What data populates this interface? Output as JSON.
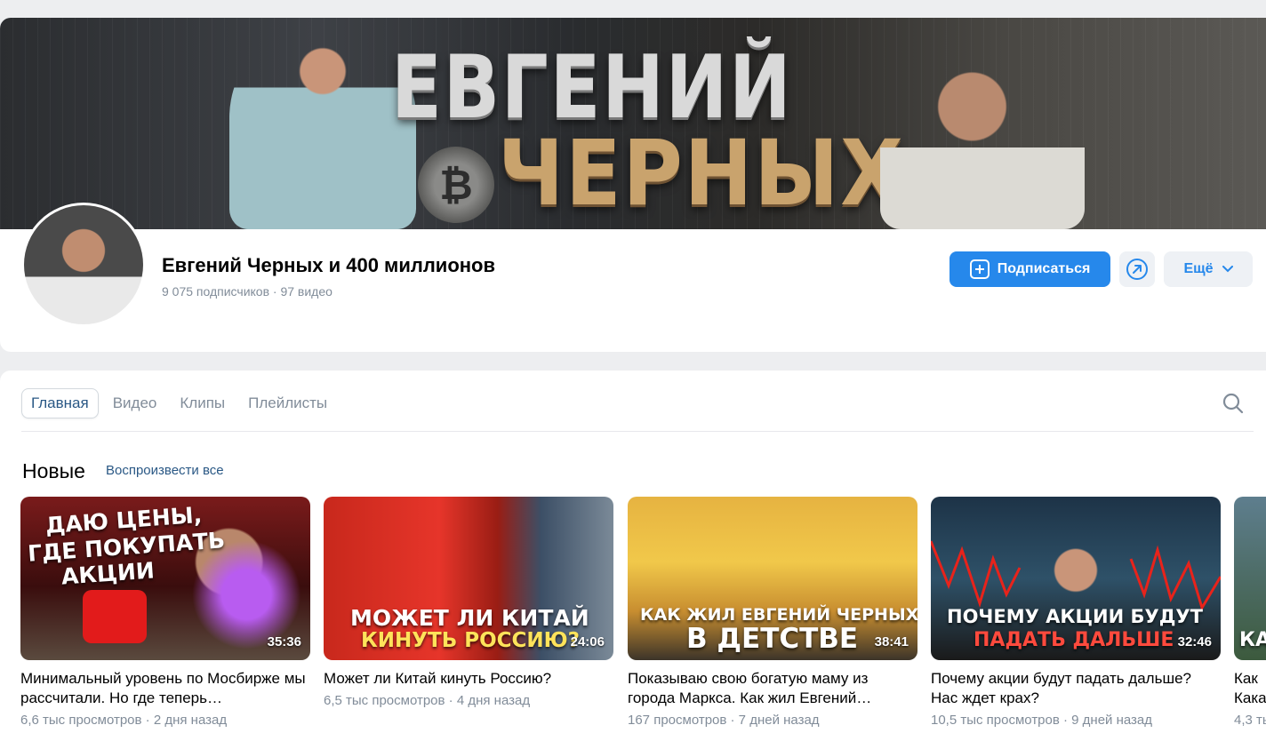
{
  "channel": {
    "cover_title_line1": "ЕВГЕНИЙ",
    "cover_title_line2": "ЧЕРНЫХ",
    "name": "Евгений Черных и 400 миллионов",
    "stats": "9 075 подписчиков · 97 видео",
    "subscribe_label": "Подписаться",
    "more_label": "Ещё",
    "accent_color": "#2688eb"
  },
  "tabs": [
    {
      "label": "Главная",
      "active": true
    },
    {
      "label": "Видео",
      "active": false
    },
    {
      "label": "Клипы",
      "active": false
    },
    {
      "label": "Плейлисты",
      "active": false
    }
  ],
  "section": {
    "title": "Новые",
    "play_all": "Воспроизвести все"
  },
  "videos": [
    {
      "thumb_text": [
        "ДАЮ ЦЕНЫ,",
        "ГДЕ ПОКУПАТЬ",
        "АКЦИИ"
      ],
      "duration": "35:36",
      "title": "Минимальный уровень по Мосбирже мы рассчитали. Но где теперь…",
      "meta": "6,6 тыс просмотров · 2 дня назад"
    },
    {
      "thumb_text": [
        "МОЖЕТ ЛИ КИТАЙ",
        "КИНУТЬ РОССИЮ?"
      ],
      "duration": "24:06",
      "title": "Может ли Китай кинуть Россию?",
      "meta": "6,5 тыс просмотров · 4 дня назад"
    },
    {
      "thumb_text": [
        "КАК ЖИЛ ЕВГЕНИЙ ЧЕРНЫХ",
        "В ДЕТСТВЕ"
      ],
      "duration": "38:41",
      "title": "Показываю свою богатую маму из города Маркса. Как жил Евгений…",
      "meta": "167 просмотров · 7 дней назад"
    },
    {
      "thumb_text": [
        "ПОЧЕМУ АКЦИИ БУДУТ",
        "ПАДАТЬ ДАЛЬШЕ"
      ],
      "duration": "32:46",
      "title": "Почему акции будут падать дальше? Нас ждет крах?",
      "meta": "10,5 тыс просмотров · 9 дней назад"
    },
    {
      "thumb_text": [
        "КА"
      ],
      "duration": "",
      "title": "Как Какая",
      "meta": "4,3 ты"
    }
  ]
}
